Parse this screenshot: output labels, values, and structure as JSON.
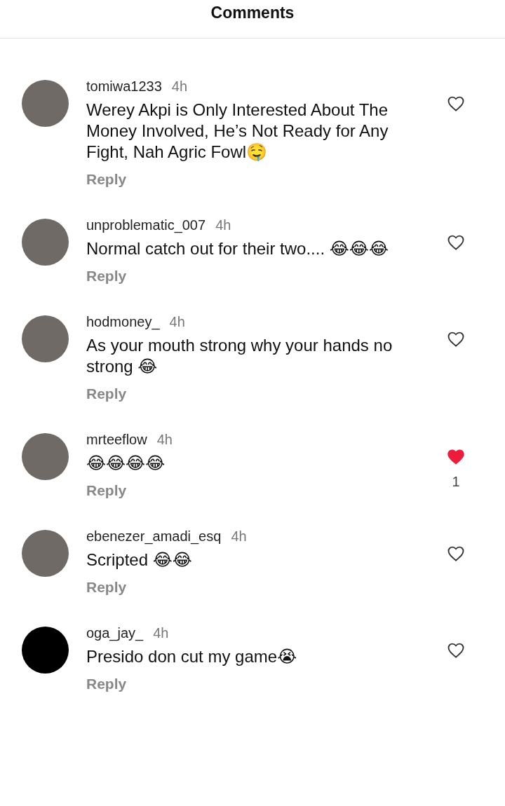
{
  "header": {
    "title": "Comments"
  },
  "comments": [
    {
      "username": "tomiwa1233",
      "time": "4h",
      "text": "Werey Akpi is Only Interested About The Money Involved, He’s Not Ready for Any Fight, Nah Agric Fowl🤤",
      "reply": "Reply",
      "liked": false
    },
    {
      "username": "unproblematic_007",
      "time": "4h",
      "text": "Normal catch out for their two.... 😂😂😂",
      "reply": "Reply",
      "liked": false
    },
    {
      "username": "hodmoney_",
      "time": "4h",
      "text": "As your mouth strong why your hands no strong 😂",
      "reply": "Reply",
      "liked": false
    },
    {
      "username": "mrteeflow",
      "time": "4h",
      "text": "😂😂😂😂",
      "reply": "Reply",
      "liked": true,
      "like_count": "1"
    },
    {
      "username": "ebenezer_amadi_esq",
      "time": "4h",
      "text": "Scripted 😂😂",
      "reply": "Reply",
      "liked": false
    },
    {
      "username": "oga_jay_",
      "time": "4h",
      "text": "Presido don cut my game😭",
      "reply": "Reply",
      "liked": false
    }
  ]
}
